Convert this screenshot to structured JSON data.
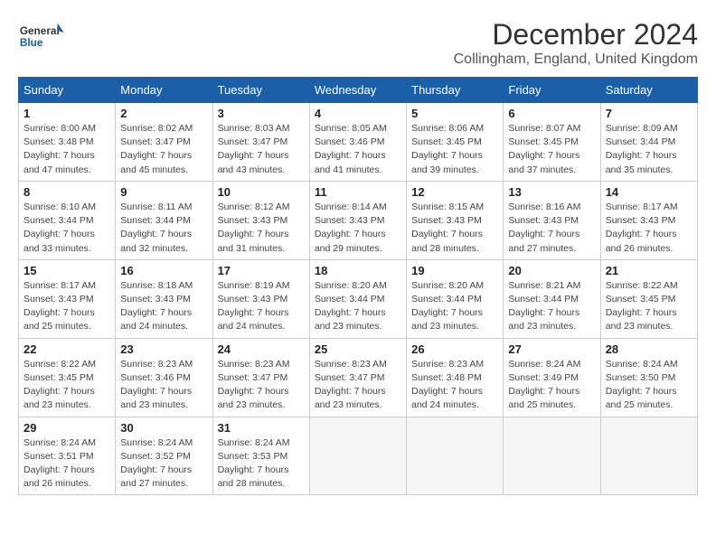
{
  "logo": {
    "line1": "General",
    "line2": "Blue"
  },
  "title": "December 2024",
  "subtitle": "Collingham, England, United Kingdom",
  "days_of_week": [
    "Sunday",
    "Monday",
    "Tuesday",
    "Wednesday",
    "Thursday",
    "Friday",
    "Saturday"
  ],
  "weeks": [
    [
      {
        "day": "1",
        "info": "Sunrise: 8:00 AM\nSunset: 3:48 PM\nDaylight: 7 hours and 47 minutes."
      },
      {
        "day": "2",
        "info": "Sunrise: 8:02 AM\nSunset: 3:47 PM\nDaylight: 7 hours and 45 minutes."
      },
      {
        "day": "3",
        "info": "Sunrise: 8:03 AM\nSunset: 3:47 PM\nDaylight: 7 hours and 43 minutes."
      },
      {
        "day": "4",
        "info": "Sunrise: 8:05 AM\nSunset: 3:46 PM\nDaylight: 7 hours and 41 minutes."
      },
      {
        "day": "5",
        "info": "Sunrise: 8:06 AM\nSunset: 3:45 PM\nDaylight: 7 hours and 39 minutes."
      },
      {
        "day": "6",
        "info": "Sunrise: 8:07 AM\nSunset: 3:45 PM\nDaylight: 7 hours and 37 minutes."
      },
      {
        "day": "7",
        "info": "Sunrise: 8:09 AM\nSunset: 3:44 PM\nDaylight: 7 hours and 35 minutes."
      }
    ],
    [
      {
        "day": "8",
        "info": "Sunrise: 8:10 AM\nSunset: 3:44 PM\nDaylight: 7 hours and 33 minutes."
      },
      {
        "day": "9",
        "info": "Sunrise: 8:11 AM\nSunset: 3:44 PM\nDaylight: 7 hours and 32 minutes."
      },
      {
        "day": "10",
        "info": "Sunrise: 8:12 AM\nSunset: 3:43 PM\nDaylight: 7 hours and 31 minutes."
      },
      {
        "day": "11",
        "info": "Sunrise: 8:14 AM\nSunset: 3:43 PM\nDaylight: 7 hours and 29 minutes."
      },
      {
        "day": "12",
        "info": "Sunrise: 8:15 AM\nSunset: 3:43 PM\nDaylight: 7 hours and 28 minutes."
      },
      {
        "day": "13",
        "info": "Sunrise: 8:16 AM\nSunset: 3:43 PM\nDaylight: 7 hours and 27 minutes."
      },
      {
        "day": "14",
        "info": "Sunrise: 8:17 AM\nSunset: 3:43 PM\nDaylight: 7 hours and 26 minutes."
      }
    ],
    [
      {
        "day": "15",
        "info": "Sunrise: 8:17 AM\nSunset: 3:43 PM\nDaylight: 7 hours and 25 minutes."
      },
      {
        "day": "16",
        "info": "Sunrise: 8:18 AM\nSunset: 3:43 PM\nDaylight: 7 hours and 24 minutes."
      },
      {
        "day": "17",
        "info": "Sunrise: 8:19 AM\nSunset: 3:43 PM\nDaylight: 7 hours and 24 minutes."
      },
      {
        "day": "18",
        "info": "Sunrise: 8:20 AM\nSunset: 3:44 PM\nDaylight: 7 hours and 23 minutes."
      },
      {
        "day": "19",
        "info": "Sunrise: 8:20 AM\nSunset: 3:44 PM\nDaylight: 7 hours and 23 minutes."
      },
      {
        "day": "20",
        "info": "Sunrise: 8:21 AM\nSunset: 3:44 PM\nDaylight: 7 hours and 23 minutes."
      },
      {
        "day": "21",
        "info": "Sunrise: 8:22 AM\nSunset: 3:45 PM\nDaylight: 7 hours and 23 minutes."
      }
    ],
    [
      {
        "day": "22",
        "info": "Sunrise: 8:22 AM\nSunset: 3:45 PM\nDaylight: 7 hours and 23 minutes."
      },
      {
        "day": "23",
        "info": "Sunrise: 8:23 AM\nSunset: 3:46 PM\nDaylight: 7 hours and 23 minutes."
      },
      {
        "day": "24",
        "info": "Sunrise: 8:23 AM\nSunset: 3:47 PM\nDaylight: 7 hours and 23 minutes."
      },
      {
        "day": "25",
        "info": "Sunrise: 8:23 AM\nSunset: 3:47 PM\nDaylight: 7 hours and 23 minutes."
      },
      {
        "day": "26",
        "info": "Sunrise: 8:23 AM\nSunset: 3:48 PM\nDaylight: 7 hours and 24 minutes."
      },
      {
        "day": "27",
        "info": "Sunrise: 8:24 AM\nSunset: 3:49 PM\nDaylight: 7 hours and 25 minutes."
      },
      {
        "day": "28",
        "info": "Sunrise: 8:24 AM\nSunset: 3:50 PM\nDaylight: 7 hours and 25 minutes."
      }
    ],
    [
      {
        "day": "29",
        "info": "Sunrise: 8:24 AM\nSunset: 3:51 PM\nDaylight: 7 hours and 26 minutes."
      },
      {
        "day": "30",
        "info": "Sunrise: 8:24 AM\nSunset: 3:52 PM\nDaylight: 7 hours and 27 minutes."
      },
      {
        "day": "31",
        "info": "Sunrise: 8:24 AM\nSunset: 3:53 PM\nDaylight: 7 hours and 28 minutes."
      },
      null,
      null,
      null,
      null
    ]
  ]
}
